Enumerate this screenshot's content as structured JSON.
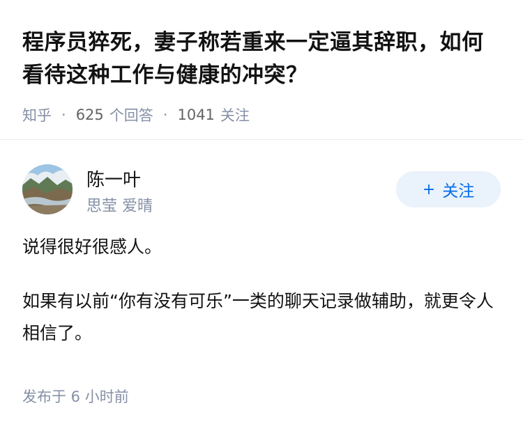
{
  "question": {
    "title": "程序员猝死，妻子称若重来一定逼其辞职，如何看待这种工作与健康的冲突？",
    "site": "知乎",
    "separator": "·",
    "answer_count": "625",
    "answer_label": "个回答",
    "follow_count": "1041",
    "follow_label": "关注"
  },
  "author": {
    "name": "陈一叶",
    "bio": "思莹 爱晴",
    "follow_button": {
      "plus": "+",
      "label": "关注"
    },
    "avatar_icon": "landscape-avatar-icon"
  },
  "answer": {
    "paragraphs": [
      "说得很好很感人。",
      "如果有以前“你有没有可乐”一类的聊天记录做辅助，就更令人相信了。"
    ],
    "footer": "发布于 6 小时前"
  },
  "colors": {
    "accent": "#056de8",
    "button_bg": "#eaf2fb",
    "meta_gray": "#8590a6",
    "text": "#121212"
  }
}
